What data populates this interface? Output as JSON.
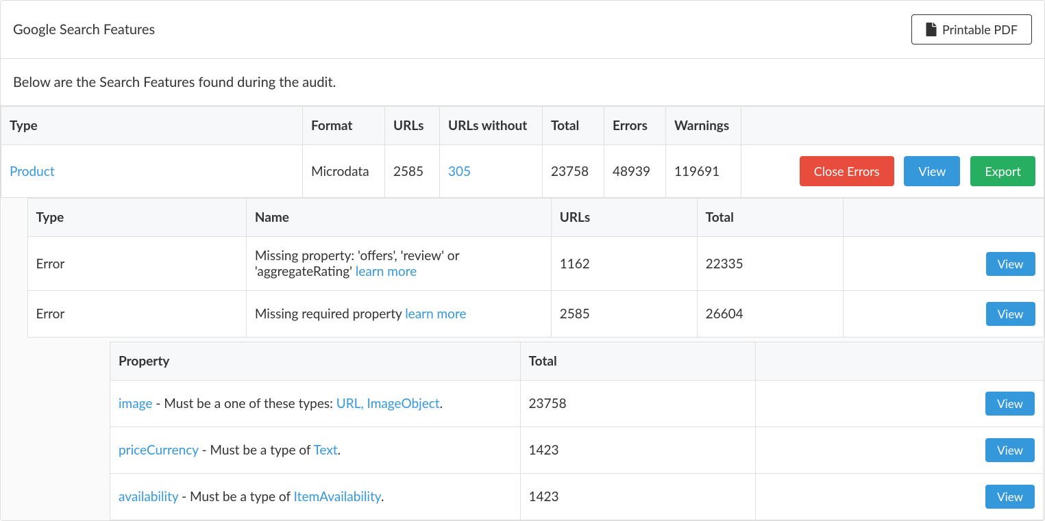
{
  "header": {
    "title": "Google Search Features",
    "printable_pdf": "Printable PDF"
  },
  "description": "Below are the Search Features found during the audit.",
  "main_table": {
    "headers": {
      "type": "Type",
      "format": "Format",
      "urls": "URLs",
      "urls_without": "URLs without",
      "total": "Total",
      "errors": "Errors",
      "warnings": "Warnings"
    },
    "row": {
      "type": "Product",
      "format": "Microdata",
      "urls": "2585",
      "urls_without": "305",
      "total": "23758",
      "errors": "48939",
      "warnings": "119691"
    },
    "buttons": {
      "close_errors": "Close Errors",
      "view": "View",
      "export": "Export"
    }
  },
  "errors_table": {
    "headers": {
      "type": "Type",
      "name": "Name",
      "urls": "URLs",
      "total": "Total"
    },
    "rows": [
      {
        "type": "Error",
        "name_pre": "Missing property: 'offers', 'review' or 'aggregateRating' ",
        "learn_more": "learn more",
        "urls": "1162",
        "total": "22335"
      },
      {
        "type": "Error",
        "name_pre": "Missing required property ",
        "learn_more": "learn more",
        "urls": "2585",
        "total": "26604"
      }
    ],
    "view_label": "View"
  },
  "properties_table": {
    "headers": {
      "property": "Property",
      "total": "Total"
    },
    "rows": [
      {
        "prop": "image",
        "mid": " - Must be a one of these types: ",
        "type_link": "URL, ImageObject",
        "tail": ".",
        "total": "23758"
      },
      {
        "prop": "priceCurrency",
        "mid": " - Must be a type of ",
        "type_link": "Text",
        "tail": ".",
        "total": "1423"
      },
      {
        "prop": "availability",
        "mid": " - Must be a type of ",
        "type_link": "ItemAvailability",
        "tail": ".",
        "total": "1423"
      }
    ],
    "view_label": "View"
  }
}
